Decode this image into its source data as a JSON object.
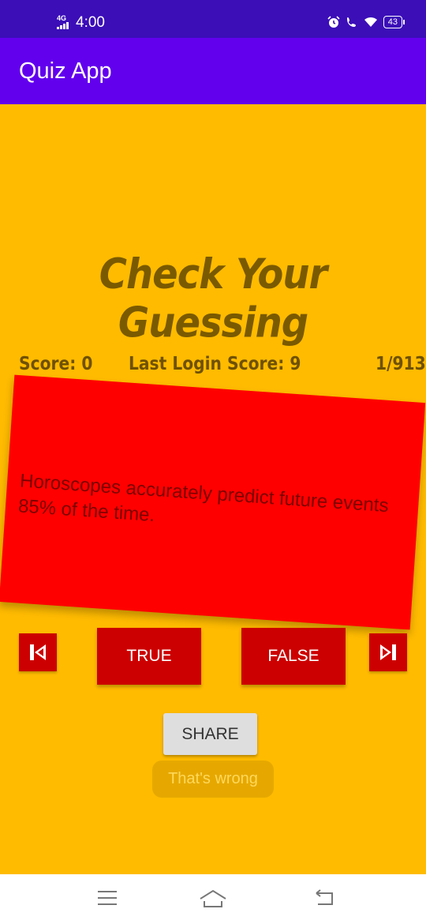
{
  "status_bar": {
    "network": "4G",
    "time": "4:00",
    "battery": "43"
  },
  "app_bar": {
    "title": "Quiz App"
  },
  "headline": "Check Your Guessing",
  "scores": {
    "score": "Score: 0",
    "last_login_score": "Last Login Score: 9",
    "progress": "1/913"
  },
  "question": {
    "text": "Horoscopes accurately predict future events 85% of the time."
  },
  "buttons": {
    "true_label": "TRUE",
    "false_label": "FALSE",
    "share_label": "SHARE"
  },
  "toast": {
    "message": "That's wrong"
  },
  "colors": {
    "background": "#FFBB00",
    "app_bar": "#6200EE",
    "status_bar": "#3B0EB8",
    "card": "#FF0000",
    "button": "#CC0000",
    "headline": "#7A5A00"
  },
  "icons": {
    "prev": "skip-previous-icon",
    "next": "skip-next-icon",
    "nav_menu": "menu-icon",
    "nav_home": "home-icon",
    "nav_back": "back-icon"
  }
}
